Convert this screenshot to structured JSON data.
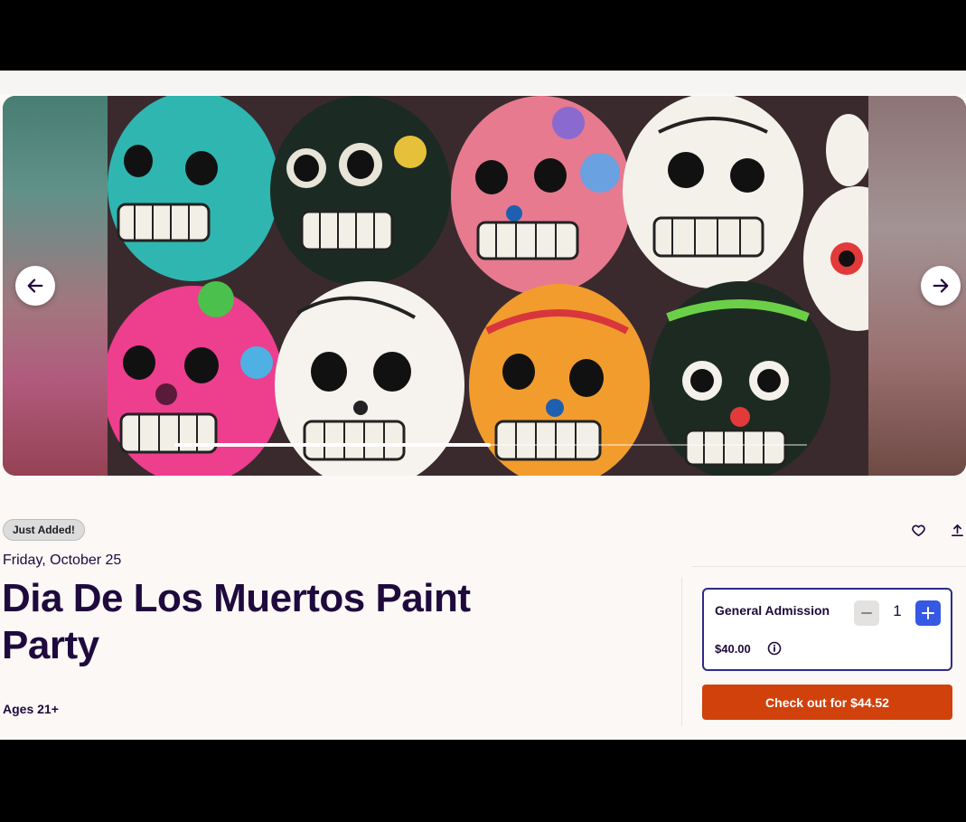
{
  "carousel": {
    "image_alt": "Colorful painted sugar skulls",
    "prev_icon": "arrow-left-icon",
    "next_icon": "arrow-right-icon",
    "progress": 0.5
  },
  "event": {
    "badge": "Just Added!",
    "date": "Friday, October 25",
    "title": "Dia De Los Muertos Paint Party",
    "ages": "Ages 21+"
  },
  "actions": {
    "like_icon": "heart-icon",
    "share_icon": "share-icon"
  },
  "ticket": {
    "name": "General Admission",
    "price": "$40.00",
    "quantity": "1",
    "info_icon": "info-icon",
    "minus_icon": "minus-icon",
    "plus_icon": "plus-icon"
  },
  "checkout": {
    "label": "Check out for $44.52"
  },
  "colors": {
    "brand_text": "#1e0a3c",
    "checkout": "#d1410c",
    "stepper_plus": "#3659e3",
    "ticket_border": "#2e2a8a"
  }
}
